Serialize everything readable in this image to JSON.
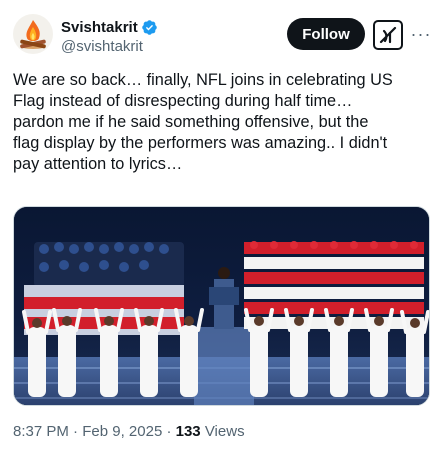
{
  "author": {
    "display_name": "Svishtakrit",
    "handle": "@svishtakrit",
    "verified": true,
    "avatar_icon": "campfire-icon"
  },
  "actions": {
    "follow_label": "Follow",
    "grok_icon": "grok-icon",
    "more_icon": "more-options-icon"
  },
  "tweet": {
    "text": "We are so back… finally, NFL joins in celebrating US\nFlag instead of disrespecting during half time…\npardon me if he said something offensive, but the\nflag display by the performers was amazing.. I didn't\npay attention to lyrics…"
  },
  "media": {
    "description_icon": "performers-photo"
  },
  "meta": {
    "time": "8:37 PM",
    "separator": "·",
    "date": "Feb 9, 2025",
    "views_count": "133",
    "views_label": "Views"
  },
  "colors": {
    "text": "#0f1419",
    "secondary": "#536471",
    "verified_blue": "#1d9bf0",
    "follow_bg": "#0f1419"
  }
}
